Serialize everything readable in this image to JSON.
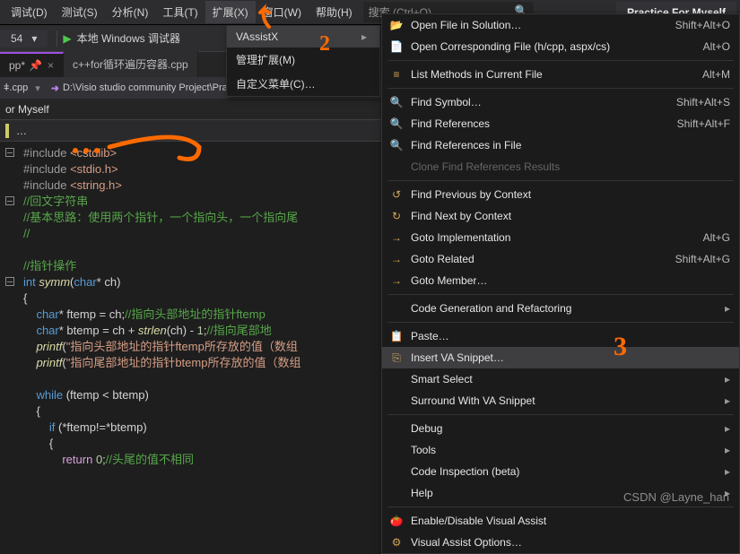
{
  "menubar": {
    "items": [
      {
        "label": "调试(D)"
      },
      {
        "label": "测试(S)"
      },
      {
        "label": "分析(N)"
      },
      {
        "label": "工具(T)"
      },
      {
        "label": "扩展(X)"
      },
      {
        "label": "窗口(W)"
      },
      {
        "label": "帮助(H)"
      }
    ],
    "search_placeholder": "搜索 (Ctrl+Q)",
    "title": "Practice For Myself"
  },
  "toolbar": {
    "config": "54",
    "run": "本地 Windows 调试器"
  },
  "submenu": {
    "items": [
      {
        "label": "VAssistX",
        "arrow": true,
        "hl": true
      },
      {
        "label": "管理扩展(M)"
      },
      {
        "label": "自定义菜单(C)…"
      }
    ]
  },
  "tabs": [
    {
      "label": "pp*",
      "active": true,
      "pinned": true
    },
    {
      "label": "c++for循环遍历容器.cpp"
    }
  ],
  "breadcrumb": {
    "file": "ǂ.cpp",
    "path": "D:\\Visio studio community Project\\Practice Fo"
  },
  "nav_head": "or Myself",
  "nav_sub": "…",
  "code": [
    {
      "gutter": "-",
      "html": "<span class='pp'>#include</span> <span class='inc'>&lt;cstdlib&gt;</span>"
    },
    {
      "html": "<span class='pp'>#include</span> <span class='inc'>&lt;stdio.h&gt;</span>"
    },
    {
      "html": "<span class='pp'>#include</span> <span class='inc'>&lt;string.h&gt;</span>"
    },
    {
      "gutter": "-",
      "html": "<span class='cm'>//回文字符串</span>"
    },
    {
      "html": "<span class='cm'>//基本思路：使用两个指针，一个指向头，一个指向尾</span>"
    },
    {
      "html": "<span class='cm'>//</span>"
    },
    {
      "html": ""
    },
    {
      "html": "<span class='cm'>//指针操作</span>"
    },
    {
      "gutter": "-",
      "html": "<span class='kw'>int</span> <span class='fn'>symm</span>(<span class='kw'>char</span>* ch)"
    },
    {
      "html": "{"
    },
    {
      "html": "    <span class='kw'>char</span>* ftemp = ch;<span class='cm'>//指向头部地址的指针ftemp</span>"
    },
    {
      "html": "    <span class='kw'>char</span>* btemp = ch + <span class='fn'>strlen</span>(ch) - <span class='num'>1</span>;<span class='cm'>//指向尾部地</span>"
    },
    {
      "html": "    <span class='fn'>printf</span>(<span class='str'>\"指向头部地址的指针ftemp所存放的值（数组</span>"
    },
    {
      "html": "    <span class='fn'>printf</span>(<span class='str'>\"指向尾部地址的指针btemp所存放的值（数组</span>"
    },
    {
      "html": ""
    },
    {
      "html": "    <span class='kw'>while</span> (ftemp &lt; btemp)"
    },
    {
      "html": "    {"
    },
    {
      "html": "        <span class='kw'>if</span> (*ftemp!=*btemp)"
    },
    {
      "html": "        {"
    },
    {
      "html": "            <span class='ret'>return</span> <span class='num'>0</span>;<span class='cm'>//头尾的值不相同</span>"
    }
  ],
  "context_menu": [
    {
      "icon": "📂",
      "label": "Open File in Solution…",
      "shortcut": "Shift+Alt+O"
    },
    {
      "icon": "📄",
      "label": "Open Corresponding File (h/cpp, aspx/cs)",
      "shortcut": "Alt+O"
    },
    {
      "sep": true
    },
    {
      "icon": "≡",
      "label": "List Methods in Current File",
      "shortcut": "Alt+M"
    },
    {
      "sep": true
    },
    {
      "icon": "🔍",
      "label": "Find Symbol…",
      "shortcut": "Shift+Alt+S"
    },
    {
      "icon": "🔍",
      "label": "Find References",
      "shortcut": "Shift+Alt+F"
    },
    {
      "icon": "🔍",
      "label": "Find References in File"
    },
    {
      "disabled": true,
      "label": "Clone Find References Results"
    },
    {
      "sep": true
    },
    {
      "icon": "↺",
      "label": "Find Previous by Context"
    },
    {
      "icon": "↻",
      "label": "Find Next by Context"
    },
    {
      "icon": "→",
      "label": "Goto Implementation",
      "shortcut": "Alt+G"
    },
    {
      "icon": "→",
      "label": "Goto Related",
      "shortcut": "Shift+Alt+G"
    },
    {
      "icon": "→",
      "label": "Goto Member…"
    },
    {
      "sep": true
    },
    {
      "label": "Code Generation and Refactoring",
      "arrow": true
    },
    {
      "sep": true
    },
    {
      "icon": "📋",
      "label": "Paste…"
    },
    {
      "icon": "⎘",
      "label": "Insert VA Snippet…",
      "hl": true
    },
    {
      "label": "Smart Select",
      "arrow": true
    },
    {
      "label": "Surround With VA Snippet",
      "arrow": true
    },
    {
      "sep": true
    },
    {
      "label": "Debug",
      "arrow": true
    },
    {
      "label": "Tools",
      "arrow": true
    },
    {
      "label": "Code Inspection (beta)",
      "arrow": true
    },
    {
      "label": "Help",
      "arrow": true
    },
    {
      "sep": true
    },
    {
      "icon": "🍅",
      "label": "Enable/Disable Visual Assist"
    },
    {
      "icon": "⚙",
      "label": "Visual Assist Options…"
    }
  ],
  "watermark": "CSDN @Layne_han"
}
